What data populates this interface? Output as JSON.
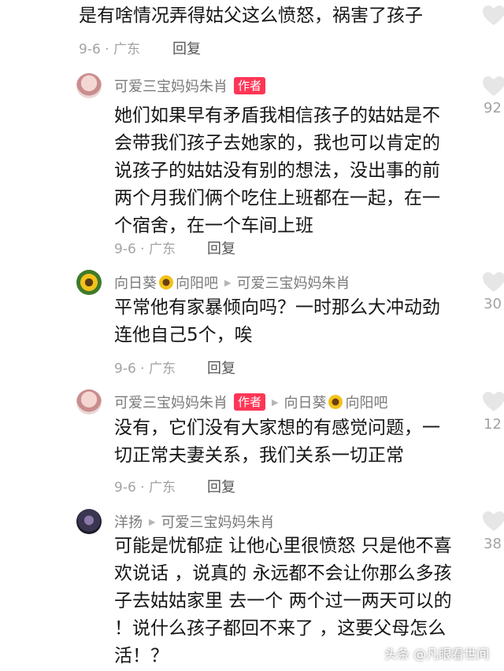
{
  "top_comment": {
    "text": "是有啥情况弄得姑父这么愤怒，祸害了孩子",
    "meta": "9-6 · 广东",
    "reply": "回复"
  },
  "comments": [
    {
      "author": "可爱三宝妈妈朱肖",
      "badge": "作者",
      "lines": [
        "她们如果早有矛盾我相信孩子的姑姑是不",
        "会带我们孩子去她家的，我也可以肯定的",
        "说孩子的姑姑没有别的想法，没出事的前",
        "两个月我们俩个吃住上班都在一起，在一",
        "个宿舍，在一个车间上班"
      ],
      "meta": "9-6 · 广东",
      "reply": "回复",
      "likes": "92"
    },
    {
      "author": "向日葵",
      "author_suffix": "向阳吧",
      "reply_to": "可爱三宝妈妈朱肖",
      "lines": [
        "平常他有家暴倾向吗？一时那么大冲动劲",
        "连他自己5个，唉"
      ],
      "meta": "9-6 · 广东",
      "reply": "回复",
      "likes": "30"
    },
    {
      "author": "可爱三宝妈妈朱肖",
      "badge": "作者",
      "reply_to": "向日葵",
      "reply_to_suffix": "向阳吧",
      "lines": [
        "没有，它们没有大家想的有感觉问题，一",
        "切正常夫妻关系，我们关系一切正常"
      ],
      "meta": "9-6 · 广东",
      "reply": "回复",
      "likes": "12"
    },
    {
      "author": "洋扬",
      "reply_to": "可爱三宝妈妈朱肖",
      "lines": [
        "可能是忧郁症 让他心里很愤怒 只是他不喜",
        "欢说话 ，说真的 永远都不会让你那么多孩",
        "子去姑姑家里 去一个 两个过一两天可以的",
        "！说什么孩子都回不来了 ，这要父母怎么",
        "活！？"
      ],
      "likes": "38"
    }
  ],
  "watermark": "头条 @凡眼看世间",
  "icons": {
    "like": "heart-outline-icon",
    "sunflower": "sunflower-emoji-icon",
    "reply_arrow": "play-arrow-icon"
  },
  "colors": {
    "author_badge": "#ff3656",
    "text": "#161616",
    "meta": "#a3a3a3",
    "heart": "#e6e6e6"
  }
}
